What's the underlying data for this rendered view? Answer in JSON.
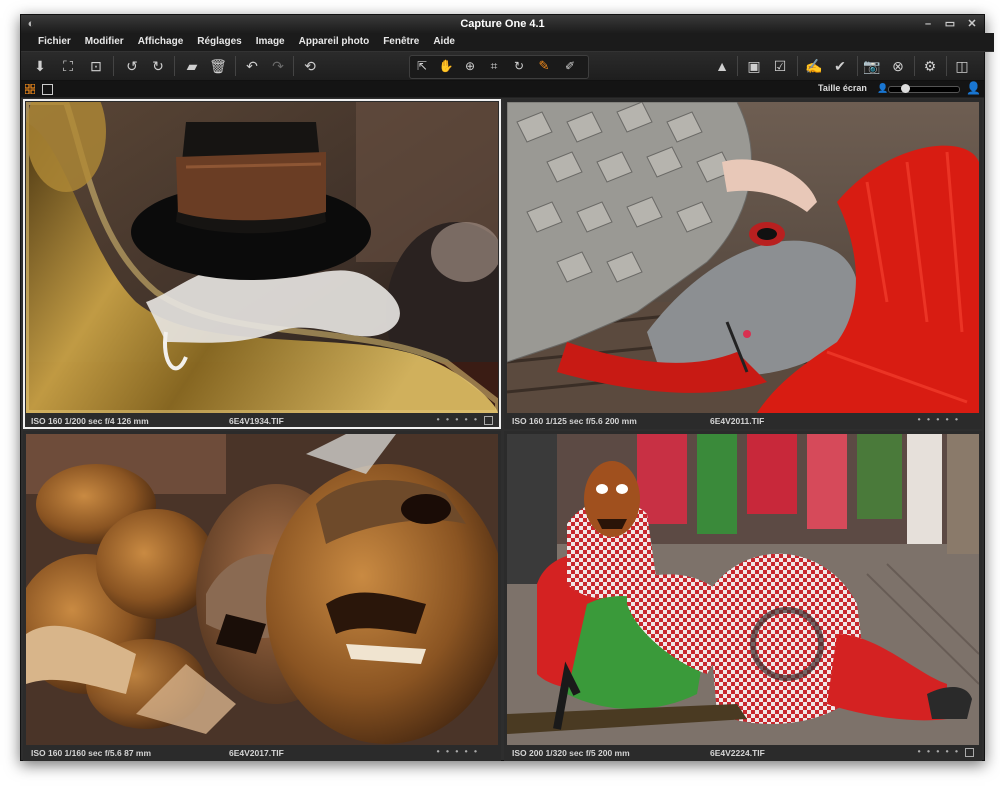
{
  "window": {
    "title": "Capture One 4.1"
  },
  "menu": [
    "Fichier",
    "Modifier",
    "Affichage",
    "Réglages",
    "Image",
    "Appareil photo",
    "Fenêtre",
    "Aide"
  ],
  "toolbar": {
    "icons": [
      "import-icon",
      "capture-icon",
      "export-icon",
      "rotate-left-icon",
      "rotate-right-icon",
      "move-to-folder-icon",
      "trash-icon",
      "undo-icon",
      "redo-icon",
      "reset-icon"
    ],
    "tools": [
      "select-tool-icon",
      "pan-tool-icon",
      "zoom-tool-icon",
      "crop-tool-icon",
      "rotate-tool-icon",
      "picker-tool-icon",
      "annotate-tool-icon"
    ],
    "right_icons": [
      "warning-icon",
      "add-image-icon",
      "check-image-icon",
      "edit-icon",
      "edit-check-icon",
      "camera-icon",
      "cancel-icon",
      "settings-icon",
      "layout-icon"
    ],
    "accent": "#f08a1c"
  },
  "viewbar": {
    "size_label": "Taille écran",
    "slider_value": 0.2
  },
  "photos": [
    {
      "iso": "ISO 160",
      "shutter": "1/200 sec",
      "aperture": "f/4",
      "focal": "126 mm",
      "meta": "ISO 160  1/200 sec  f/4  126 mm",
      "filename": "6E4V1934.TIF",
      "selected": true
    },
    {
      "iso": "ISO 160",
      "shutter": "1/125 sec",
      "aperture": "f/5.6",
      "focal": "200 mm",
      "meta": "ISO 160  1/125 sec  f/5.6  200 mm",
      "filename": "6E4V2011.TIF",
      "selected": false
    },
    {
      "iso": "ISO 160",
      "shutter": "1/160 sec",
      "aperture": "f/5.6",
      "focal": "87 mm",
      "meta": "ISO 160  1/160 sec  f/5.6  87 mm",
      "filename": "6E4V2017.TIF",
      "selected": false
    },
    {
      "iso": "ISO 200",
      "shutter": "1/320 sec",
      "aperture": "f/5",
      "focal": "200 mm",
      "meta": "ISO 200  1/320 sec  f/5  200 mm",
      "filename": "6E4V2224.TIF",
      "selected": false
    }
  ],
  "caption_dots": "• • • • •"
}
